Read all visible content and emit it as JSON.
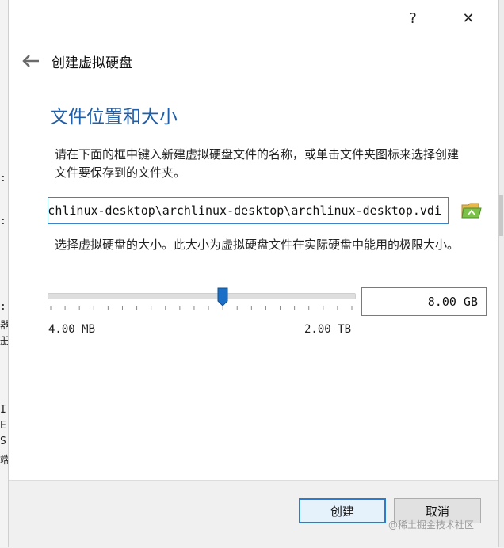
{
  "dialog": {
    "help_label": "?",
    "close_label": "✕",
    "header_title": "创建虚拟硬盘",
    "section_title": "文件位置和大小",
    "description_location": "请在下面的框中键入新建虚拟硬盘文件的名称，或单击文件夹图标来选择创建文件要保存到的文件夹。",
    "file_path": "rchlinux-desktop\\archlinux-desktop\\archlinux-desktop.vdi",
    "description_size": "选择虚拟硬盘的大小。此大小为虚拟硬盘文件在实际硬盘中能用的极限大小。",
    "size_slider": {
      "value_fraction": 0.57
    },
    "size_value": "8.00 GB",
    "min_label": "4.00 MB",
    "max_label": "2.00 TB",
    "buttons": {
      "create": "创建",
      "cancel": "取消"
    }
  },
  "background": {
    "left_glyphs": [
      ":",
      ":",
      ":",
      "器",
      "册",
      "I",
      "E",
      "S",
      "端"
    ]
  },
  "watermark": "@稀土掘金技术社区",
  "colors": {
    "accent": "#1f5fa8",
    "focus_border": "#3c84c8",
    "slider_handle": "#1b6fc7",
    "folder": "#6bb83a"
  },
  "icons": {
    "back": "arrow-left-icon",
    "folder": "folder-open-icon"
  }
}
